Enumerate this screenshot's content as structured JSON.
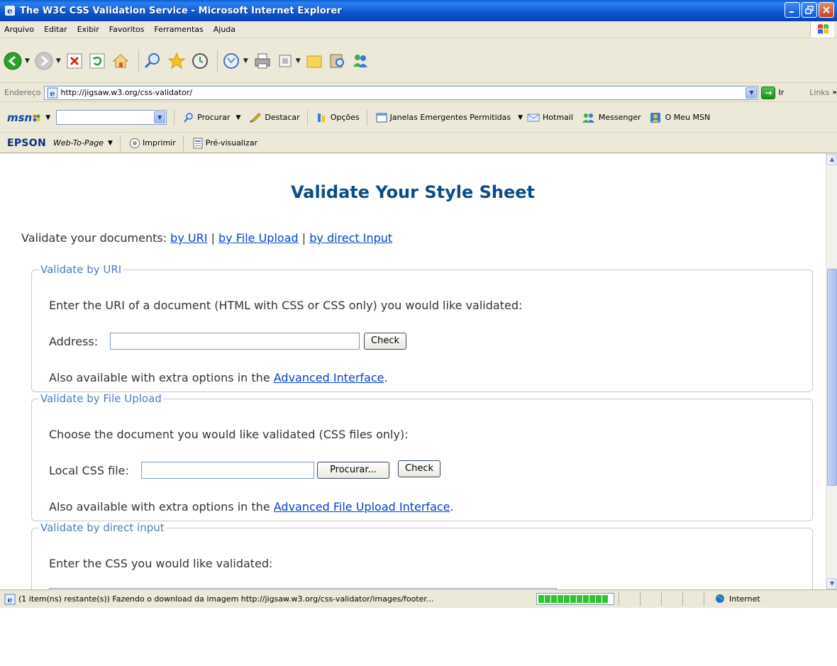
{
  "window": {
    "title": "The W3C CSS Validation Service - Microsoft Internet Explorer"
  },
  "menu": {
    "items": [
      "Arquivo",
      "Editar",
      "Exibir",
      "Favoritos",
      "Ferramentas",
      "Ajuda"
    ]
  },
  "address": {
    "label": "Endereço",
    "url": "http://jigsaw.w3.org/css-validator/",
    "go_label": "Ir",
    "links_label": "Links"
  },
  "msn": {
    "logo": "msn",
    "search_label": "Procurar",
    "highlight_label": "Destacar",
    "options_label": "Opções",
    "popups_label": "Janelas Emergentes Permitidas",
    "hotmail_label": "Hotmail",
    "messenger_label": "Messenger",
    "mymsn_label": "O Meu MSN"
  },
  "epson": {
    "brand": "EPSON",
    "webtopage": "Web-To-Page",
    "print_label": "Imprimir",
    "preview_label": "Pré-visualizar"
  },
  "page": {
    "title": "Validate Your Style Sheet",
    "nav_prefix": "Validate your documents:",
    "nav_uri": "by URI",
    "nav_upload": "by File Upload",
    "nav_direct": "by direct Input",
    "sep": "|",
    "uri": {
      "legend": "Validate by URI",
      "instructions": "Enter the URI of a document (HTML with CSS or CSS only) you would like validated:",
      "address_label": "Address:",
      "check_label": "Check",
      "also_prefix": "Also available with extra options in the",
      "also_link": "Advanced Interface",
      "also_suffix": "."
    },
    "upload": {
      "legend": "Validate by File Upload",
      "instructions": "Choose the document you would like validated (CSS files only):",
      "file_label": "Local CSS file:",
      "browse_label": "Procurar...",
      "check_label": "Check",
      "also_prefix": "Also available with extra options in the",
      "also_link": "Advanced File Upload Interface",
      "also_suffix": "."
    },
    "direct": {
      "legend": "Validate by direct input",
      "instructions": "Enter the CSS you would like validated:"
    }
  },
  "status": {
    "text": "(1 item(ns) restante(s)) Fazendo o download da imagem http://jigsaw.w3.org/css-validator/images/footer...",
    "zone": "Internet",
    "progress": 1.0
  },
  "colors": {
    "title_blue": "#0b4b88",
    "legend_blue": "#4a7dc4",
    "link_blue": "#0044cc"
  }
}
